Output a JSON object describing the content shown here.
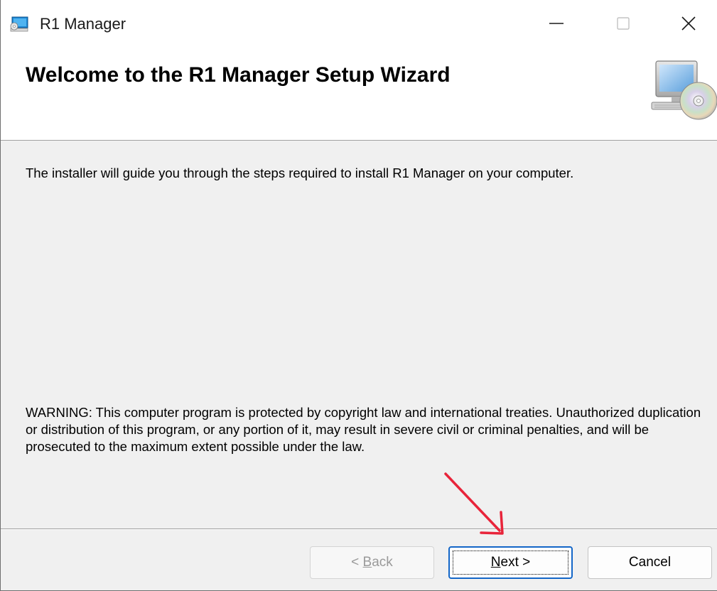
{
  "window": {
    "title": "R1 Manager",
    "icon": "installer-icon",
    "controls": {
      "minimize_icon": "minimize-icon",
      "maximize_icon": "maximize-icon",
      "close_icon": "close-icon"
    }
  },
  "banner": {
    "title": "Welcome to the R1 Manager Setup Wizard",
    "icon": "computer-cd-icon"
  },
  "body": {
    "intro": "The installer will guide you through the steps required to install R1 Manager on your computer.",
    "warning": "WARNING: This computer program is protected by copyright law and international treaties. Unauthorized duplication or distribution of this program, or any portion of it, may result in severe civil or criminal penalties, and will be prosecuted to the maximum extent possible under the law."
  },
  "buttons": {
    "back": {
      "label_prefix": "< ",
      "mnemonic": "B",
      "label_rest": "ack",
      "enabled": false
    },
    "next": {
      "mnemonic": "N",
      "label_rest": "ext >"
    },
    "cancel": {
      "label": "Cancel"
    }
  },
  "colors": {
    "accent": "#1366c8",
    "annotation_arrow": "#e8243a"
  }
}
